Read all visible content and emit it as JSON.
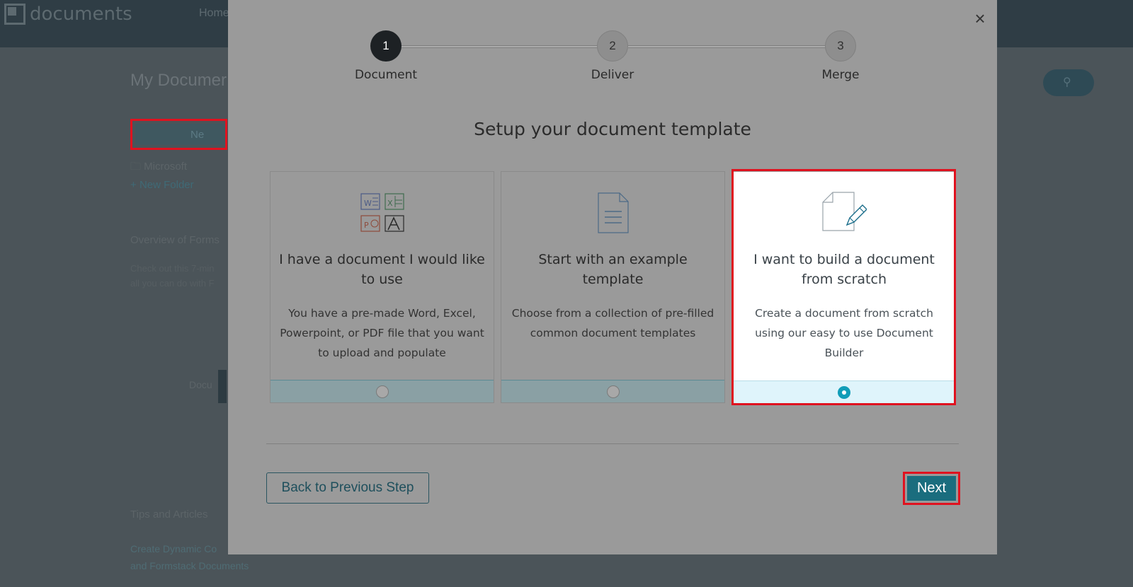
{
  "app": {
    "logo_text": "documents",
    "nav_home": "Home",
    "page_title": "My Documer",
    "new_button_label": "Ne",
    "folder_microsoft": "Microsoft",
    "new_folder": "New Folder",
    "overview_heading": "Overview of Forms",
    "overview_text_line1": "Check out this 7-min",
    "overview_text_line2": "all you can do with F",
    "docu_label": "Docu",
    "tips_heading": "Tips and Articles",
    "tips_link_line1": "Create Dynamic Co",
    "tips_link_line2": "and Formstack Documents"
  },
  "modal": {
    "close_label": "×",
    "steps": [
      {
        "number": "1",
        "label": "Document",
        "state": "active"
      },
      {
        "number": "2",
        "label": "Deliver",
        "state": "inactive"
      },
      {
        "number": "3",
        "label": "Merge",
        "state": "inactive"
      }
    ],
    "heading": "Setup your document template",
    "options": [
      {
        "icon": "office-files-icon",
        "title": "I have a document I would like to use",
        "description": "You have a pre-made Word, Excel, Powerpoint, or PDF file that you want to upload and populate",
        "selected": false
      },
      {
        "icon": "document-lines-icon",
        "title": "Start with an example template",
        "description": "Choose from a collection of pre-filled common document templates",
        "selected": false
      },
      {
        "icon": "document-pencil-icon",
        "title": "I want to build a document from scratch",
        "description": "Create a document from scratch using our easy to use Document Builder",
        "selected": true
      }
    ],
    "back_button": "Back to Previous Step",
    "next_button": "Next"
  },
  "colors": {
    "accent": "#119db8",
    "primary_button": "#1a6d7e",
    "highlight": "#e0121f"
  }
}
